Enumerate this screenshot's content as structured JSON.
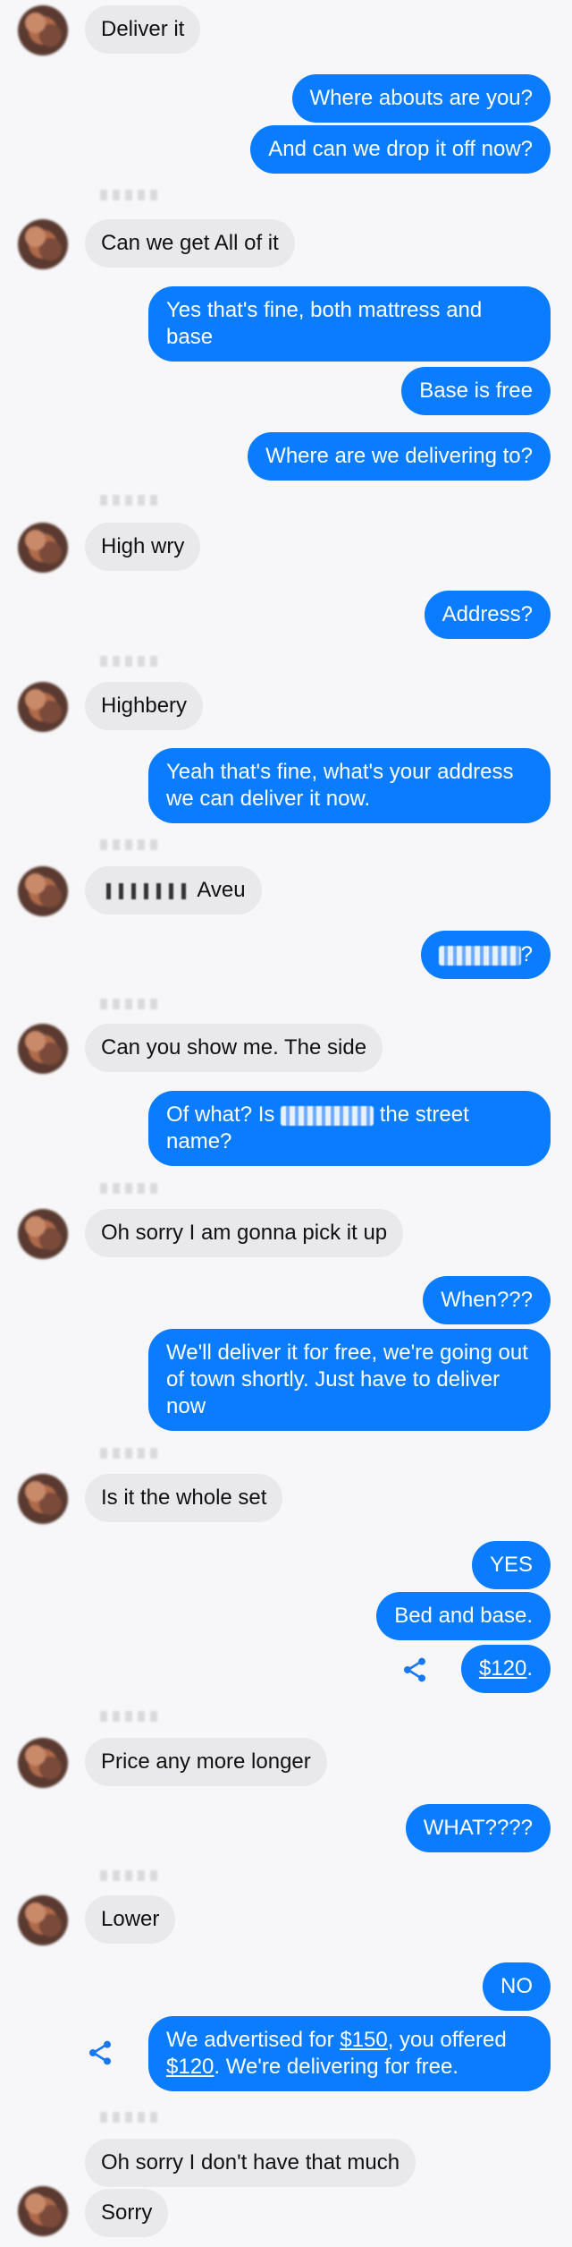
{
  "messages": {
    "m1": "Deliver it",
    "m2": "Where abouts are you?",
    "m3": "And can we drop it off now?",
    "m4": "Can we get All of it",
    "m5": "Yes that's fine, both mattress and base",
    "m6": "Base is free",
    "m7": "Where are we delivering to?",
    "m8": "High wry",
    "m9": "Address?",
    "m10": "Highbery",
    "m11": "Yeah that's fine, what's your address we can deliver it now.",
    "m12": "Aveu",
    "m13": "?",
    "m14": "Can you show me. The  side",
    "m15a": "Of what? Is",
    "m15b": "the street name?",
    "m16": "Oh sorry I am gonna pick it up",
    "m17": "When???",
    "m18": "We'll deliver it for free, we're going out of town shortly. Just have to deliver now",
    "m19": "Is it the whole set",
    "m20": "YES",
    "m21": "Bed and base.",
    "m22_link": "$120",
    "m22_tail": ".",
    "m23": "Price any more longer",
    "m24": "WHAT????",
    "m25": "Lower",
    "m26": "NO",
    "m27_a": "We advertised for ",
    "m27_link1": "$150",
    "m27_b": ", you offered ",
    "m27_link2": "$120",
    "m27_c": ". We're delivering for free.",
    "m28": "Oh sorry I don't have that much",
    "m29": "Sorry"
  },
  "colors": {
    "outgoing_bubble": "#0a7cff",
    "incoming_bubble": "#e9e9ec",
    "background": "#f7f7f9",
    "share_icon": "#1877f2"
  },
  "icons": {
    "share": "share-icon",
    "avatar": "avatar"
  }
}
